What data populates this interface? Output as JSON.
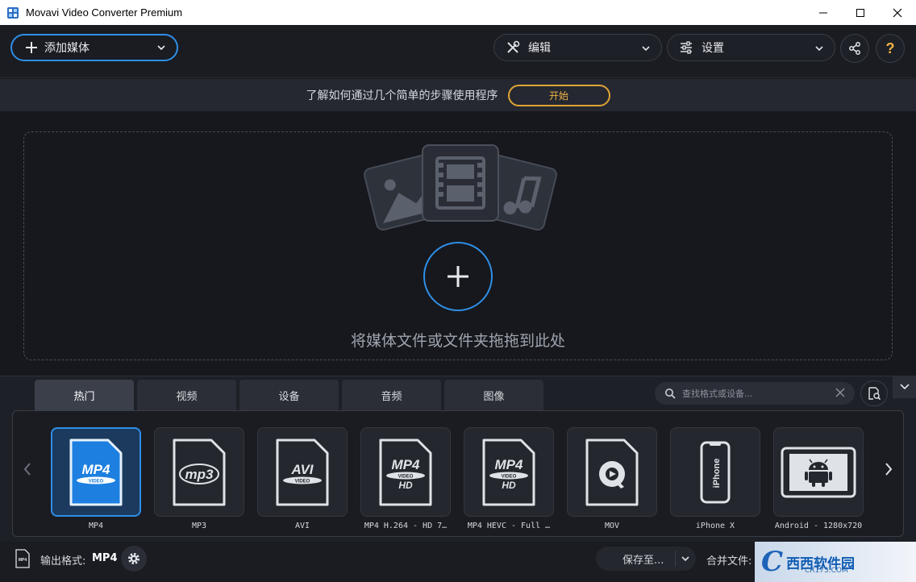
{
  "window": {
    "title": "Movavi Video Converter Premium"
  },
  "toolbar": {
    "add_media_label": "添加媒体",
    "edit_label": "编辑",
    "settings_label": "设置",
    "help_label": "?"
  },
  "banner": {
    "message": "了解如何通过几个简单的步骤使用程序",
    "start_label": "开始"
  },
  "dropzone": {
    "hint": "将媒体文件或文件夹拖拖到此处"
  },
  "tabs": [
    {
      "label": "热门",
      "active": true
    },
    {
      "label": "视频",
      "active": false
    },
    {
      "label": "设备",
      "active": false
    },
    {
      "label": "音频",
      "active": false
    },
    {
      "label": "图像",
      "active": false
    }
  ],
  "search": {
    "placeholder": "查找格式或设备..."
  },
  "formats": [
    {
      "label": "MP4",
      "icon": "mp4-icon",
      "badge": "MP4",
      "sub": "VIDEO"
    },
    {
      "label": "MP3",
      "icon": "mp3-icon",
      "badge": "mp3",
      "sub": ""
    },
    {
      "label": "AVI",
      "icon": "avi-icon",
      "badge": "AVI",
      "sub": "VIDEO"
    },
    {
      "label": "MP4 H.264 - HD 7…",
      "icon": "mp4-hd-icon",
      "badge": "MP4",
      "sub": "VIDEO",
      "hd": "HD"
    },
    {
      "label": "MP4 HEVC - Full …",
      "icon": "mp4-hevc-icon",
      "badge": "MP4",
      "sub": "VIDEO",
      "hd": "HD"
    },
    {
      "label": "MOV",
      "icon": "quicktime-icon"
    },
    {
      "label": "iPhone X",
      "icon": "iphone-icon",
      "badge": "iPhone"
    },
    {
      "label": "Android - 1280x720",
      "icon": "android-tablet-icon"
    }
  ],
  "status": {
    "output_format_label": "输出格式:",
    "output_format_value": "MP4",
    "file_icon_text": "MP4",
    "save_to_label": "保存至...",
    "merge_label": "合并文件:"
  },
  "watermark": {
    "brand": "西西软件园",
    "domain": "CR173.COM"
  },
  "colors": {
    "accent": "#2f8fe6",
    "start_button": "#e0a436",
    "background": "#16181d"
  }
}
